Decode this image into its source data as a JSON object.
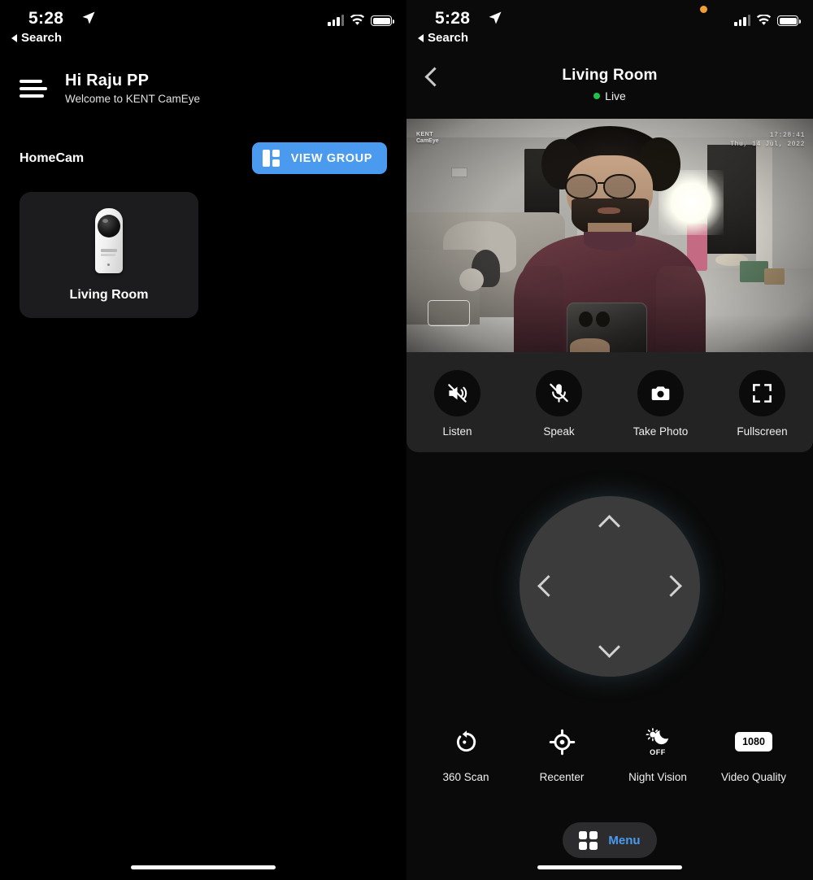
{
  "left_screen": {
    "status_bar": {
      "time": "5:28",
      "back_app": "Search",
      "location_icon": "location-arrow-icon",
      "cellular_icon": "cellular-signal-icon",
      "wifi_icon": "wifi-icon",
      "battery_icon": "battery-full-icon"
    },
    "header": {
      "menu_icon": "hamburger-menu-icon",
      "greeting": "Hi Raju PP",
      "subtitle": "Welcome to KENT CamEye"
    },
    "group": {
      "title": "HomeCam",
      "view_group_label": "VIEW GROUP",
      "view_group_icon": "grid-layout-icon",
      "accent_color": "#4a9af0"
    },
    "cameras": [
      {
        "name": "Living Room",
        "device_icon": "security-camera-icon"
      }
    ]
  },
  "right_screen": {
    "status_bar": {
      "time": "5:28",
      "back_app": "Search",
      "mic_in_use_indicator": "orange-recording-dot",
      "mic_indicator_color": "#f0a030",
      "location_icon": "location-arrow-icon",
      "cellular_icon": "cellular-signal-icon",
      "wifi_icon": "wifi-icon",
      "battery_icon": "battery-full-icon"
    },
    "nav": {
      "back_icon": "chevron-left-icon",
      "title": "Living Room",
      "status_label": "Live",
      "status_color": "#1fc24a"
    },
    "video": {
      "watermark_line1": "KENT",
      "watermark_line2": "CamEye",
      "timestamp_time": "17:28:41",
      "timestamp_date": "Thu, 14 Jul, 2022",
      "detection_box": "motion-detection-box"
    },
    "media_controls": [
      {
        "label": "Listen",
        "icon": "speaker-muted-icon"
      },
      {
        "label": "Speak",
        "icon": "microphone-muted-icon"
      },
      {
        "label": "Take Photo",
        "icon": "camera-icon"
      },
      {
        "label": "Fullscreen",
        "icon": "fullscreen-expand-icon"
      }
    ],
    "dpad": {
      "up_icon": "chevron-up-icon",
      "down_icon": "chevron-down-icon",
      "left_icon": "chevron-left-icon",
      "right_icon": "chevron-right-icon"
    },
    "features": [
      {
        "label": "360 Scan",
        "icon": "rotate-360-icon",
        "value": ""
      },
      {
        "label": "Recenter",
        "icon": "crosshair-icon",
        "value": ""
      },
      {
        "label": "Night Vision",
        "icon": "sun-moon-icon",
        "value": "OFF"
      },
      {
        "label": "Video Quality",
        "icon": "resolution-chip",
        "value": "1080"
      }
    ],
    "menu": {
      "label": "Menu",
      "icon": "grid-four-squares-icon",
      "label_color": "#4a9af0"
    }
  }
}
